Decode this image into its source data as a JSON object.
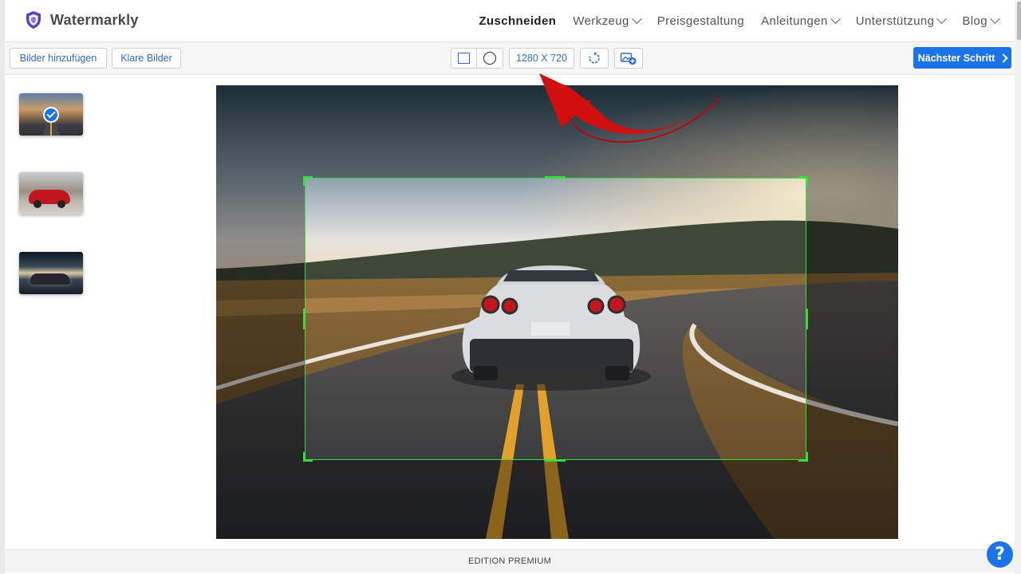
{
  "brand": {
    "name": "Watermarkly",
    "logo_icon": "shield-icon",
    "accent": "#1a73e8"
  },
  "nav": {
    "items": [
      {
        "label": "Zuschneiden",
        "active": true,
        "dropdown": false
      },
      {
        "label": "Werkzeug",
        "dropdown": true
      },
      {
        "label": "Preisgestaltung",
        "dropdown": false
      },
      {
        "label": "Anleitungen",
        "dropdown": true
      },
      {
        "label": "Unterstützung",
        "dropdown": true
      },
      {
        "label": "Blog",
        "dropdown": true
      }
    ]
  },
  "toolbar": {
    "add_images": "Bilder hinzufügen",
    "clear_images": "Klare Bilder",
    "crop_shapes": [
      "square-icon",
      "circle-icon"
    ],
    "crop_size": "1280 X 720",
    "rotate_icon": "rotate-icon",
    "add_image_icon": "add-image-icon",
    "next_step": "Nächster Schritt"
  },
  "thumbnails": [
    {
      "name": "road-car-sunset",
      "selected": true
    },
    {
      "name": "red-porsche",
      "selected": false
    },
    {
      "name": "gray-sports-car",
      "selected": false
    }
  ],
  "crop": {
    "color": "#35e03a"
  },
  "annotation": {
    "color": "#d10f0f",
    "points_to": "crop-size-button"
  },
  "footer": {
    "edition": "EDITION PREMIUM"
  },
  "help": {
    "label": "?"
  }
}
